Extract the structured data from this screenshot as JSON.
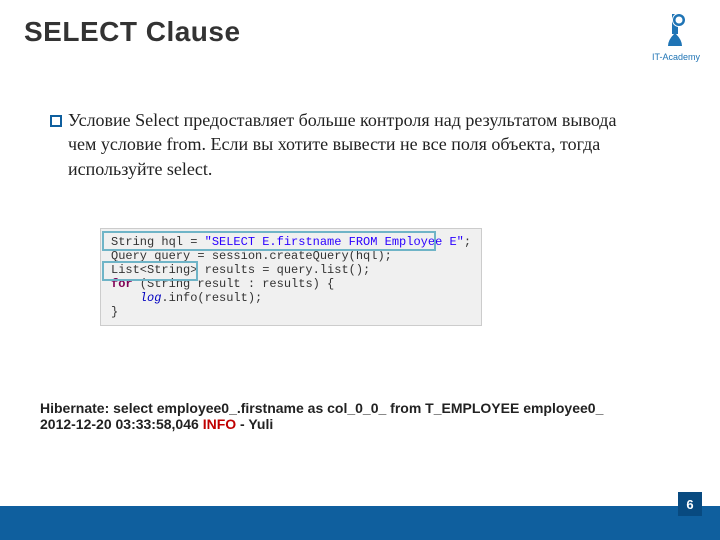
{
  "title": "SELECT Clause",
  "logo": {
    "caption": "IT-Academy"
  },
  "bullet": "Условие Select предоставляет больше контроля над результатом вывода чем условие from. Если вы хотите вывести не все поля объекта, тогда используйте select.",
  "code": {
    "l1_a": "String hql = ",
    "l1_b": "\"SELECT E.firstname FROM Employee E\"",
    "l1_c": ";",
    "l2_a": "Query query = session.createQuery(hql);",
    "l3_a": "List<String> results = query.list();",
    "l4_kw": "for",
    "l4_rest": " (String result : results) {",
    "l5_a": "    ",
    "l5_id": "log",
    "l5_b": ".info(result);",
    "l6": "}"
  },
  "log": {
    "line1": "Hibernate: select employee0_.firstname as col_0_0_ from T_EMPLOYEE employee0_",
    "line2_a": "2012-12-20 03:33:58,046 ",
    "line2_info": "INFO ",
    "line2_b": " -  Yuli"
  },
  "page_number": "6"
}
